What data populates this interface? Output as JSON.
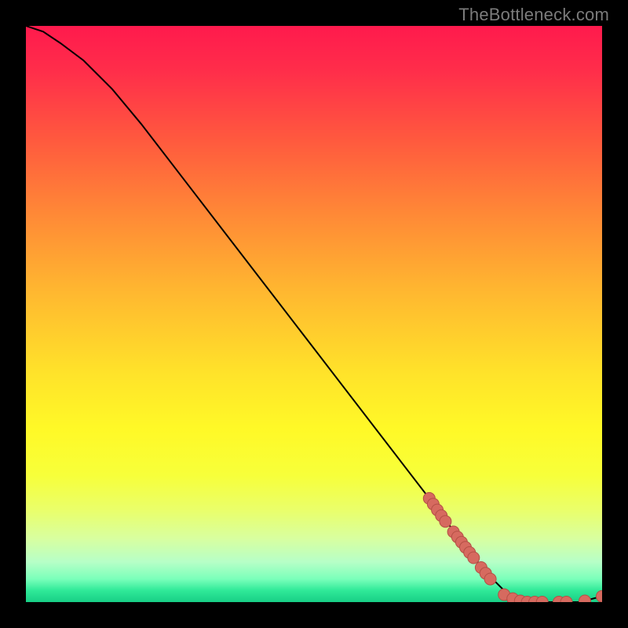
{
  "watermark": "TheBottleneck.com",
  "colors": {
    "background": "#000000",
    "curve": "#000000",
    "dot_fill": "#d66a5f",
    "dot_stroke": "#b44f45"
  },
  "chart_data": {
    "type": "line",
    "title": "",
    "xlabel": "",
    "ylabel": "",
    "xlim": [
      0,
      100
    ],
    "ylim": [
      0,
      100
    ],
    "grid": false,
    "legend": false,
    "series": [
      {
        "name": "bottleneck-curve",
        "x": [
          0,
          3,
          6,
          10,
          15,
          20,
          30,
          40,
          50,
          60,
          70,
          76,
          80,
          84,
          88,
          92,
          96,
          100
        ],
        "y": [
          100,
          99,
          97,
          94,
          89,
          83,
          70,
          57,
          44,
          31,
          18,
          10,
          5,
          1,
          0,
          0,
          0,
          1
        ]
      }
    ],
    "points": [
      {
        "name": "cluster-upper",
        "x": 70.0,
        "y": 18.0
      },
      {
        "name": "cluster-upper",
        "x": 70.7,
        "y": 17.0
      },
      {
        "name": "cluster-upper",
        "x": 71.4,
        "y": 16.0
      },
      {
        "name": "cluster-upper",
        "x": 72.1,
        "y": 15.0
      },
      {
        "name": "cluster-upper",
        "x": 72.8,
        "y": 14.0
      },
      {
        "name": "cluster-mid",
        "x": 74.2,
        "y": 12.2
      },
      {
        "name": "cluster-mid",
        "x": 74.9,
        "y": 11.3
      },
      {
        "name": "cluster-mid",
        "x": 75.6,
        "y": 10.4
      },
      {
        "name": "cluster-mid",
        "x": 76.3,
        "y": 9.5
      },
      {
        "name": "cluster-mid",
        "x": 77.0,
        "y": 8.6
      },
      {
        "name": "cluster-mid",
        "x": 77.7,
        "y": 7.7
      },
      {
        "name": "cluster-low",
        "x": 79.0,
        "y": 6.0
      },
      {
        "name": "cluster-low",
        "x": 79.8,
        "y": 5.0
      },
      {
        "name": "cluster-low",
        "x": 80.6,
        "y": 4.0
      },
      {
        "name": "flat",
        "x": 83.0,
        "y": 1.3
      },
      {
        "name": "flat",
        "x": 84.5,
        "y": 0.6
      },
      {
        "name": "flat",
        "x": 85.8,
        "y": 0.2
      },
      {
        "name": "flat",
        "x": 87.0,
        "y": 0.0
      },
      {
        "name": "flat",
        "x": 88.3,
        "y": 0.0
      },
      {
        "name": "flat",
        "x": 89.6,
        "y": 0.0
      },
      {
        "name": "flat",
        "x": 92.5,
        "y": 0.0
      },
      {
        "name": "flat",
        "x": 93.8,
        "y": 0.0
      },
      {
        "name": "flat",
        "x": 97.0,
        "y": 0.2
      },
      {
        "name": "flat-end",
        "x": 100.0,
        "y": 1.0
      }
    ]
  }
}
